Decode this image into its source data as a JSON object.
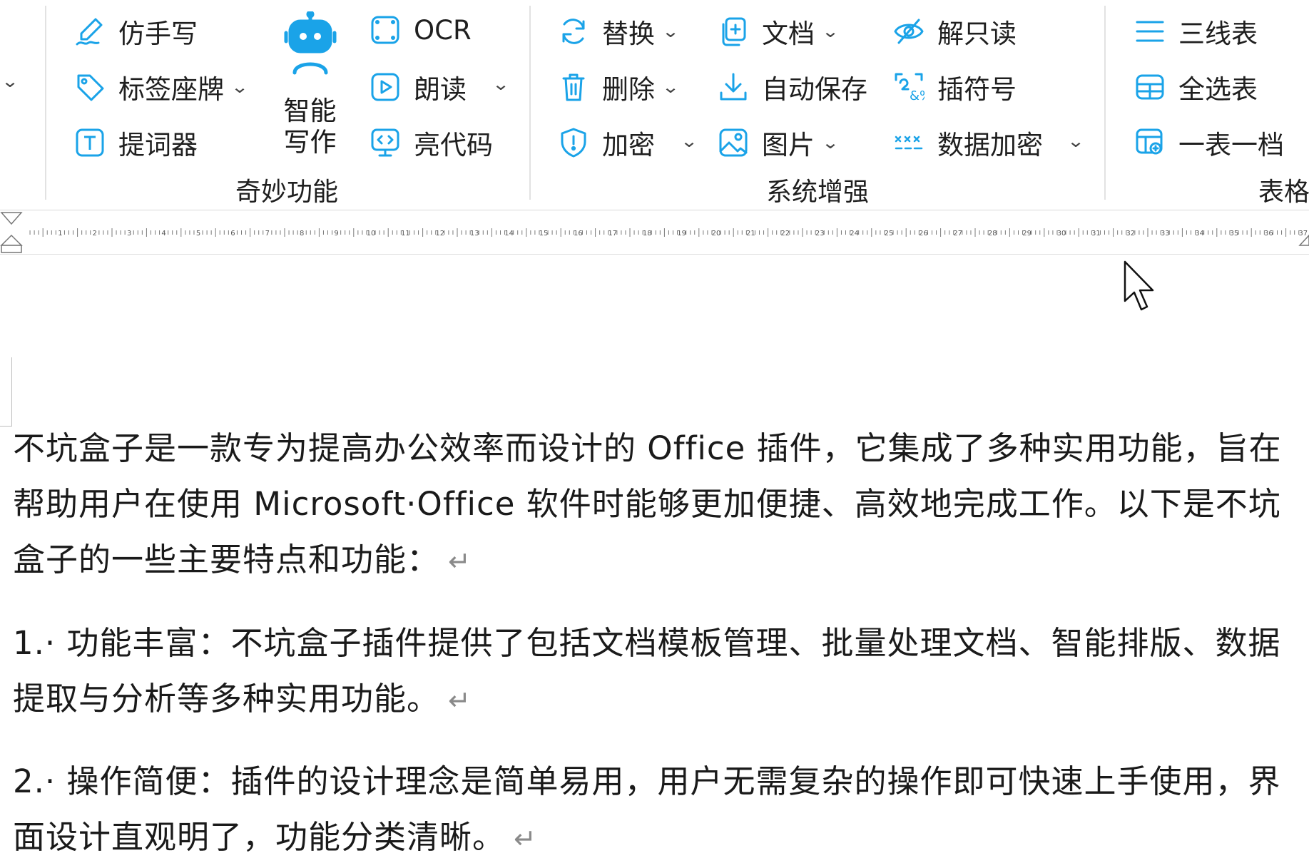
{
  "ribbon": {
    "groups": [
      {
        "label": "奇妙功能",
        "items": [
          {
            "label": "仿手写",
            "icon": "handwriting-pen-icon"
          },
          {
            "label": "标签座牌",
            "icon": "tag-icon"
          },
          {
            "label": "提词器",
            "icon": "teleprompter-icon"
          },
          {
            "label": "OCR",
            "icon": "ocr-icon"
          },
          {
            "label": "朗读",
            "icon": "read-aloud-icon"
          },
          {
            "label": "亮代码",
            "icon": "code-highlight-icon"
          }
        ],
        "big_button": {
          "label_line1": "智能",
          "label_line2": "写作",
          "icon": "robot-icon"
        }
      },
      {
        "label": "系统增强",
        "items": [
          {
            "label": "替换",
            "icon": "replace-icon"
          },
          {
            "label": "删除",
            "icon": "trash-icon"
          },
          {
            "label": "加密",
            "icon": "shield-icon"
          },
          {
            "label": "文档",
            "icon": "document-copy-icon"
          },
          {
            "label": "自动保存",
            "icon": "download-save-icon"
          },
          {
            "label": "图片",
            "icon": "image-icon"
          },
          {
            "label": "解只读",
            "icon": "unlock-eye-icon"
          },
          {
            "label": "插符号",
            "icon": "symbol-insert-icon"
          },
          {
            "label": "数据加密",
            "icon": "data-mask-icon"
          }
        ]
      },
      {
        "label": "表格",
        "items": [
          {
            "label": "三线表",
            "icon": "three-line-table-icon"
          },
          {
            "label": "全选表",
            "icon": "select-table-icon"
          },
          {
            "label": "一表一档",
            "icon": "table-export-icon"
          }
        ]
      }
    ]
  },
  "ruler": {
    "numbers": [
      "1",
      "2",
      "3",
      "4",
      "5",
      "6",
      "7",
      "8",
      "9",
      "10",
      "11",
      "12",
      "13",
      "14",
      "15",
      "16",
      "17",
      "18",
      "19",
      "20",
      "21",
      "22",
      "23",
      "24",
      "25",
      "26",
      "27",
      "28",
      "29",
      "30",
      "31",
      "32",
      "33",
      "34",
      "35",
      "36",
      "37"
    ]
  },
  "document": {
    "paragraphs": [
      "不坑盒子是一款专为提高办公效率而设计的 Office 插件，它集成了多种实用功能，旨在帮助用户在使用 Microsoft·Office 软件时能够更加便捷、高效地完成工作。以下是不坑盒子的一些主要特点和功能：",
      "1.· 功能丰富：不坑盒子插件提供了包括文档模板管理、批量处理文档、智能排版、数据提取与分析等多种实用功能。",
      "2.· 操作简便：插件的设计理念是简单易用，用户无需复杂的操作即可快速上手使用，界面设计直观明了，功能分类清晰。"
    ],
    "paragraph_mark": "↵"
  },
  "colors": {
    "accent": "#1aa3e8",
    "text": "#1a1a1a",
    "paragraph_mark": "#8a8a8a"
  }
}
